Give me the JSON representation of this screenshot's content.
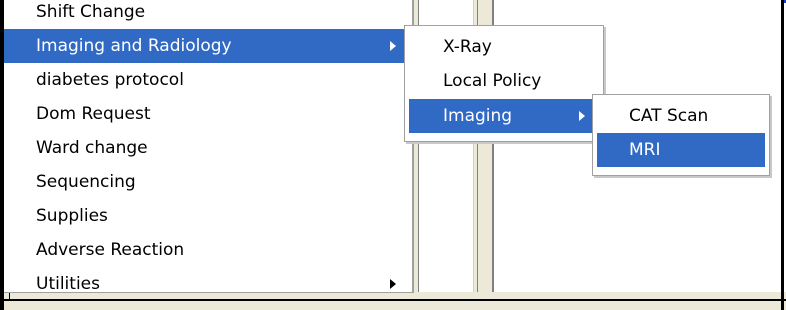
{
  "menu_main": {
    "items": [
      {
        "label": "Shift Change"
      },
      {
        "label": "Imaging and Radiology"
      },
      {
        "label": "diabetes protocol"
      },
      {
        "label": "Dom Request"
      },
      {
        "label": "Ward change"
      },
      {
        "label": "Sequencing"
      },
      {
        "label": "Supplies"
      },
      {
        "label": "Adverse Reaction"
      },
      {
        "label": "Utilities"
      }
    ]
  },
  "menu_sub": {
    "items": [
      {
        "label": "X-Ray"
      },
      {
        "label": "Local Policy"
      },
      {
        "label": "Imaging"
      }
    ]
  },
  "menu_sub2": {
    "items": [
      {
        "label": "CAT Scan"
      },
      {
        "label": "MRI"
      }
    ]
  },
  "colors": {
    "selection": "#316ac5",
    "panel": "#ece9d8",
    "accent_top": "#1a3fc4"
  }
}
